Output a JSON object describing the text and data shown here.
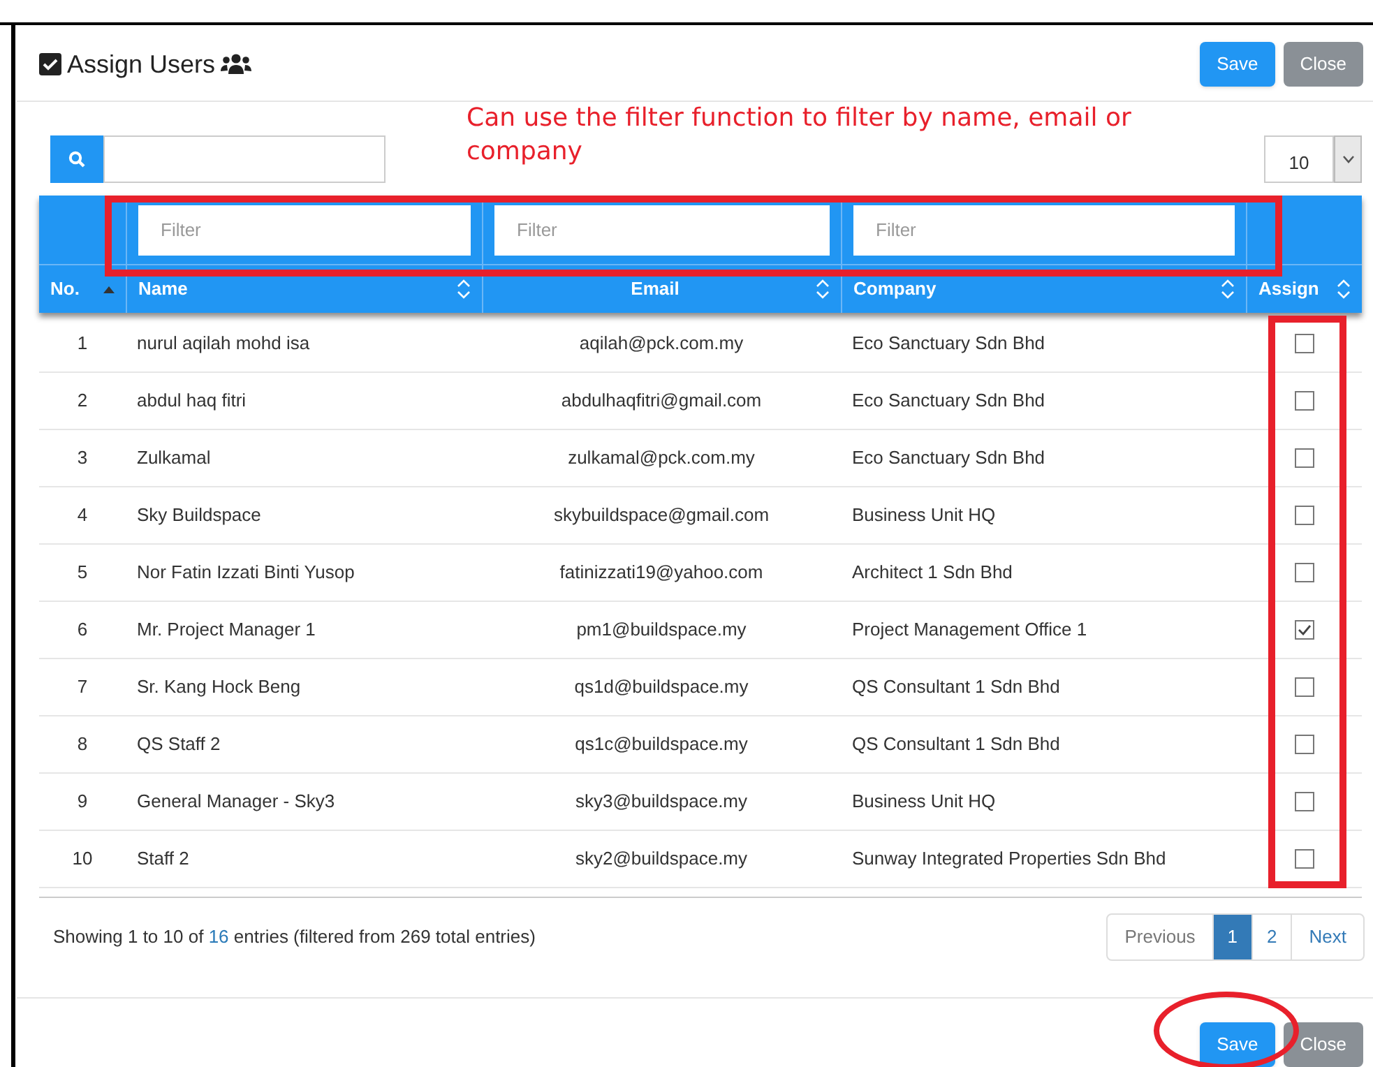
{
  "modal": {
    "title": "Assign Users",
    "header_buttons": [
      {
        "label": "Save",
        "kind": "primary"
      },
      {
        "label": "Close",
        "kind": "secondary"
      }
    ]
  },
  "annotation": {
    "text": "Can use the filter function to filter by name, email or company"
  },
  "page_length": {
    "value": "10"
  },
  "table": {
    "filters": [
      {
        "placeholder": "Filter"
      },
      {
        "placeholder": "Filter"
      },
      {
        "placeholder": "Filter"
      }
    ],
    "columns": [
      {
        "label": "No.",
        "kind": "sorted"
      },
      {
        "label": "Name",
        "kind": "sortable"
      },
      {
        "label": "Email",
        "kind": "sortable"
      },
      {
        "label": "Company",
        "kind": "sortable"
      },
      {
        "label": "Assign",
        "kind": "sortable"
      }
    ],
    "rows": [
      {
        "no": "1",
        "name": "nurul aqilah mohd isa",
        "email": "aqilah@pck.com.my",
        "company": "Eco Sanctuary Sdn Bhd",
        "checked": false
      },
      {
        "no": "2",
        "name": "abdul haq fitri",
        "email": "abdulhaqfitri@gmail.com",
        "company": "Eco Sanctuary Sdn Bhd",
        "checked": false
      },
      {
        "no": "3",
        "name": "Zulkamal",
        "email": "zulkamal@pck.com.my",
        "company": "Eco Sanctuary Sdn Bhd",
        "checked": false
      },
      {
        "no": "4",
        "name": "Sky Buildspace",
        "email": "skybuildspace@gmail.com",
        "company": "Business Unit HQ",
        "checked": false
      },
      {
        "no": "5",
        "name": "Nor Fatin Izzati Binti Yusop",
        "email": "fatinizzati19@yahoo.com",
        "company": "Architect 1 Sdn Bhd",
        "checked": false
      },
      {
        "no": "6",
        "name": "Mr. Project Manager 1",
        "email": "pm1@buildspace.my",
        "company": "Project Management Office 1",
        "checked": true
      },
      {
        "no": "7",
        "name": "Sr. Kang Hock Beng",
        "email": "qs1d@buildspace.my",
        "company": "QS Consultant 1 Sdn Bhd",
        "checked": false
      },
      {
        "no": "8",
        "name": "QS Staff 2",
        "email": "qs1c@buildspace.my",
        "company": "QS Consultant 1 Sdn Bhd",
        "checked": false
      },
      {
        "no": "9",
        "name": "General Manager - Sky3",
        "email": "sky3@buildspace.my",
        "company": "Business Unit HQ",
        "checked": false
      },
      {
        "no": "10",
        "name": "Staff 2",
        "email": "sky2@buildspace.my",
        "company": "Sunway Integrated Properties Sdn Bhd",
        "checked": false
      }
    ]
  },
  "info": {
    "before": "Showing 1 to 10 of",
    "count": "16",
    "after": "entries (filtered from 269 total entries)"
  },
  "pagination": [
    {
      "label": "Previous",
      "kind": "nav",
      "selected": false
    },
    {
      "label": "1",
      "kind": "page",
      "selected": true
    },
    {
      "label": "2",
      "kind": "page",
      "selected": false
    },
    {
      "label": "Next",
      "kind": "nav",
      "selected": false
    }
  ],
  "footer_buttons": [
    {
      "label": "Save",
      "kind": "primary"
    },
    {
      "label": "Close",
      "kind": "secondary"
    }
  ]
}
